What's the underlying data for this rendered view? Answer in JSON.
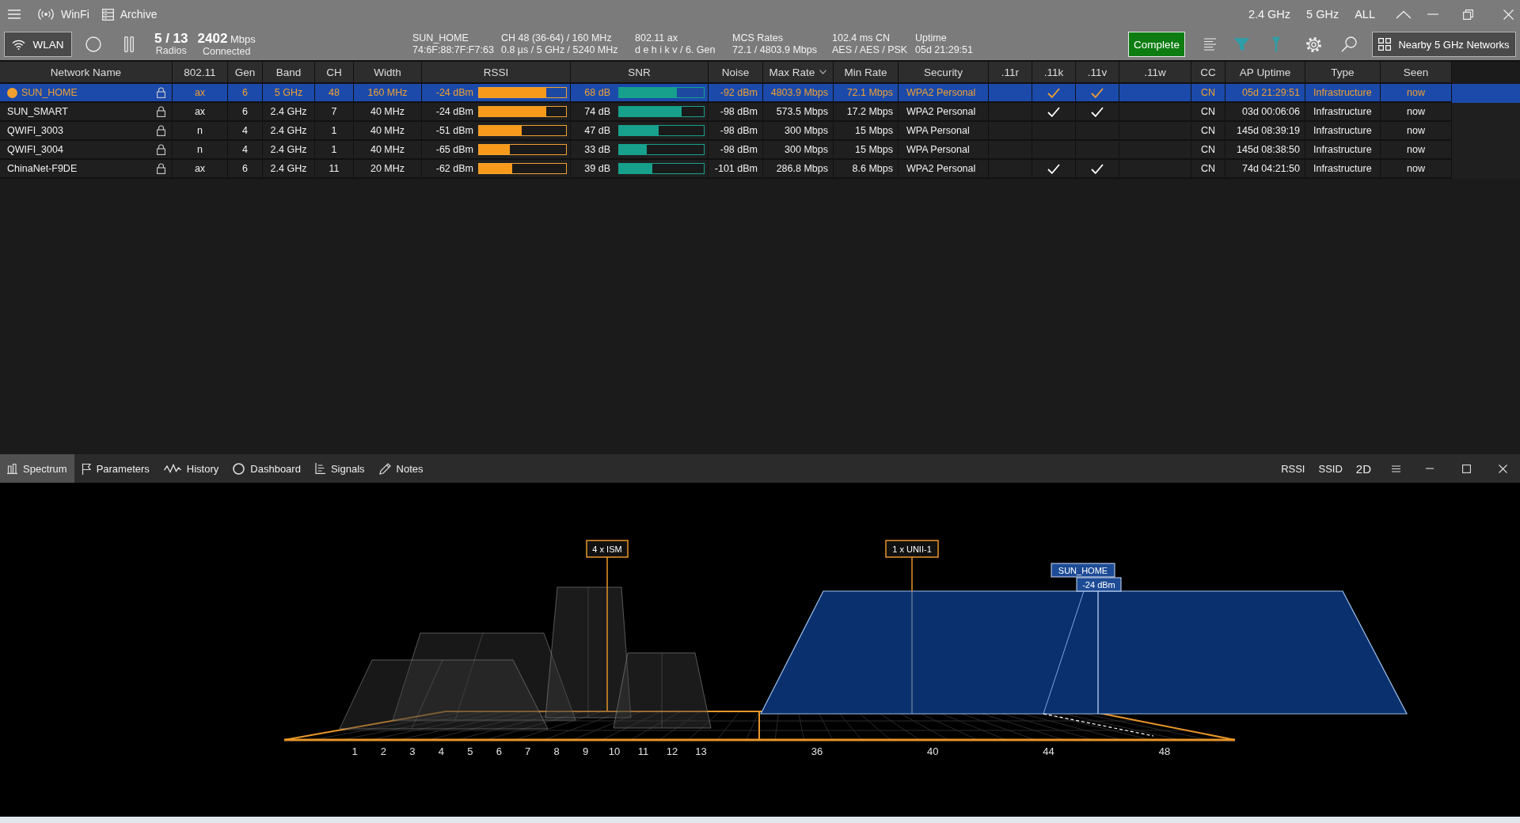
{
  "title_bar": {
    "nav": [
      {
        "label": "WinFi"
      },
      {
        "label": "Archive"
      }
    ],
    "band_filters": [
      {
        "label": "2.4 GHz"
      },
      {
        "label": "5 GHz"
      },
      {
        "label": "ALL"
      }
    ]
  },
  "toolbar": {
    "interface_button": "WLAN",
    "radios": {
      "value": "5 / 13",
      "label": "Radios"
    },
    "throughput": {
      "value": "**2402** Mbps",
      "label": "Connected"
    },
    "details": [
      {
        "top": "SUN_HOME",
        "bottom": "74:6F:88:7F:F7:63"
      },
      {
        "top": "CH 48 (36-64) / 160 MHz",
        "bottom": "0.8 µs / 5 GHz / 5240 MHz"
      },
      {
        "top": "802.11 ax",
        "bottom": "d e h i k v / 6. Gen"
      },
      {
        "top": "MCS Rates",
        "bottom": "72.1 / 4803.9 Mbps"
      },
      {
        "top": "102.4 ms CN",
        "bottom": "AES / AES / PSK"
      },
      {
        "top": "Uptime",
        "bottom": "05d 21:29:51"
      }
    ],
    "status_button": "Complete",
    "nearby_button": "Nearby 5 GHz Networks"
  },
  "table": {
    "columns": [
      {
        "label": "Network Name",
        "sorted": false
      },
      {
        "label": "802.11",
        "sorted": false
      },
      {
        "label": "Gen",
        "sorted": false
      },
      {
        "label": "Band",
        "sorted": false
      },
      {
        "label": "CH",
        "sorted": false
      },
      {
        "label": "Width",
        "sorted": false
      },
      {
        "label": "RSSI",
        "sorted": false
      },
      {
        "label": "SNR",
        "sorted": false
      },
      {
        "label": "Noise",
        "sorted": false
      },
      {
        "label": "Max Rate",
        "sorted": true
      },
      {
        "label": "Min Rate",
        "sorted": false
      },
      {
        "label": "Security",
        "sorted": false
      },
      {
        "label": ".11r",
        "sorted": false
      },
      {
        "label": ".11k",
        "sorted": false
      },
      {
        "label": ".11v",
        "sorted": false
      },
      {
        "label": ".11w",
        "sorted": false
      },
      {
        "label": "CC",
        "sorted": false
      },
      {
        "label": "AP Uptime",
        "sorted": false
      },
      {
        "label": "Type",
        "sorted": false
      },
      {
        "label": "Seen",
        "sorted": false
      }
    ],
    "rows": [
      {
        "name": "SUN_HOME",
        "standard": "ax",
        "gen": "6",
        "band": "5 GHz",
        "ch": "48",
        "width": "160 MHz",
        "rssi": {
          "reading": "-24 dBm",
          "level": 0.77
        },
        "snr": {
          "reading": "68 dB",
          "level": 0.68
        },
        "noise": "-92 dBm",
        "max_rate": "4803.9 Mbps",
        "min_rate": "72.1 Mbps",
        "security": "WPA2 Personal",
        "dot11k": true,
        "dot11v": true,
        "cc": "CN",
        "ap_uptime": "05d 21:29:51",
        "type": "Infrastructure",
        "seen": "now",
        "selected": true,
        "connected": true
      },
      {
        "name": "SUN_SMART",
        "standard": "ax",
        "gen": "6",
        "band": "2.4 GHz",
        "ch": "7",
        "width": "40 MHz",
        "rssi": {
          "reading": "-24 dBm",
          "level": 0.77
        },
        "snr": {
          "reading": "74 dB",
          "level": 0.74
        },
        "noise": "-98 dBm",
        "max_rate": "573.5 Mbps",
        "min_rate": "17.2 Mbps",
        "security": "WPA2 Personal",
        "dot11k": true,
        "dot11v": true,
        "cc": "CN",
        "ap_uptime": "03d 00:06:06",
        "type": "Infrastructure",
        "seen": "now",
        "selected": false,
        "connected": false
      },
      {
        "name": "QWIFI_3003",
        "standard": "n",
        "gen": "4",
        "band": "2.4 GHz",
        "ch": "1",
        "width": "40 MHz",
        "rssi": {
          "reading": "-51 dBm",
          "level": 0.49
        },
        "snr": {
          "reading": "47 dB",
          "level": 0.47
        },
        "noise": "-98 dBm",
        "max_rate": "300 Mbps",
        "min_rate": "15 Mbps",
        "security": "WPA Personal",
        "dot11k": false,
        "dot11v": false,
        "cc": "CN",
        "ap_uptime": "145d 08:39:19",
        "type": "Infrastructure",
        "seen": "now",
        "selected": false,
        "connected": false
      },
      {
        "name": "QWIFI_3004",
        "standard": "n",
        "gen": "4",
        "band": "2.4 GHz",
        "ch": "1",
        "width": "40 MHz",
        "rssi": {
          "reading": "-65 dBm",
          "level": 0.35
        },
        "snr": {
          "reading": "33 dB",
          "level": 0.33
        },
        "noise": "-98 dBm",
        "max_rate": "300 Mbps",
        "min_rate": "15 Mbps",
        "security": "WPA Personal",
        "dot11k": false,
        "dot11v": false,
        "cc": "CN",
        "ap_uptime": "145d 08:38:50",
        "type": "Infrastructure",
        "seen": "now",
        "selected": false,
        "connected": false
      },
      {
        "name": "ChinaNet-F9DE",
        "standard": "ax",
        "gen": "6",
        "band": "2.4 GHz",
        "ch": "11",
        "width": "20 MHz",
        "rssi": {
          "reading": "-62 dBm",
          "level": 0.38
        },
        "snr": {
          "reading": "39 dB",
          "level": 0.39
        },
        "noise": "-101 dBm",
        "max_rate": "286.8 Mbps",
        "min_rate": "8.6 Mbps",
        "security": "WPA2 Personal",
        "dot11k": true,
        "dot11v": true,
        "cc": "CN",
        "ap_uptime": "74d 04:21:50",
        "type": "Infrastructure",
        "seen": "now",
        "selected": false,
        "connected": false
      }
    ]
  },
  "bottom_panel": {
    "tabs": [
      {
        "label": "Spectrum",
        "selected": true
      },
      {
        "label": "Parameters",
        "selected": false
      },
      {
        "label": "History",
        "selected": false
      },
      {
        "label": "Dashboard",
        "selected": false
      },
      {
        "label": "Signals",
        "selected": false
      },
      {
        "label": "Notes",
        "selected": false
      }
    ],
    "options": [
      {
        "label": "RSSI"
      },
      {
        "label": "SSID"
      },
      {
        "label": "2D"
      }
    ]
  },
  "spectrum": {
    "channels_2_4": [
      "1",
      "2",
      "3",
      "4",
      "5",
      "6",
      "7",
      "8",
      "9",
      "10",
      "11",
      "12",
      "13"
    ],
    "channels_5": [
      "36",
      "40",
      "44",
      "48"
    ],
    "band_groups": [
      {
        "label": "4 x ISM"
      },
      {
        "label": "1 x UNII-1"
      }
    ],
    "network_callout": {
      "ssid": "SUN_HOME",
      "reading": "-24 dBm"
    }
  }
}
